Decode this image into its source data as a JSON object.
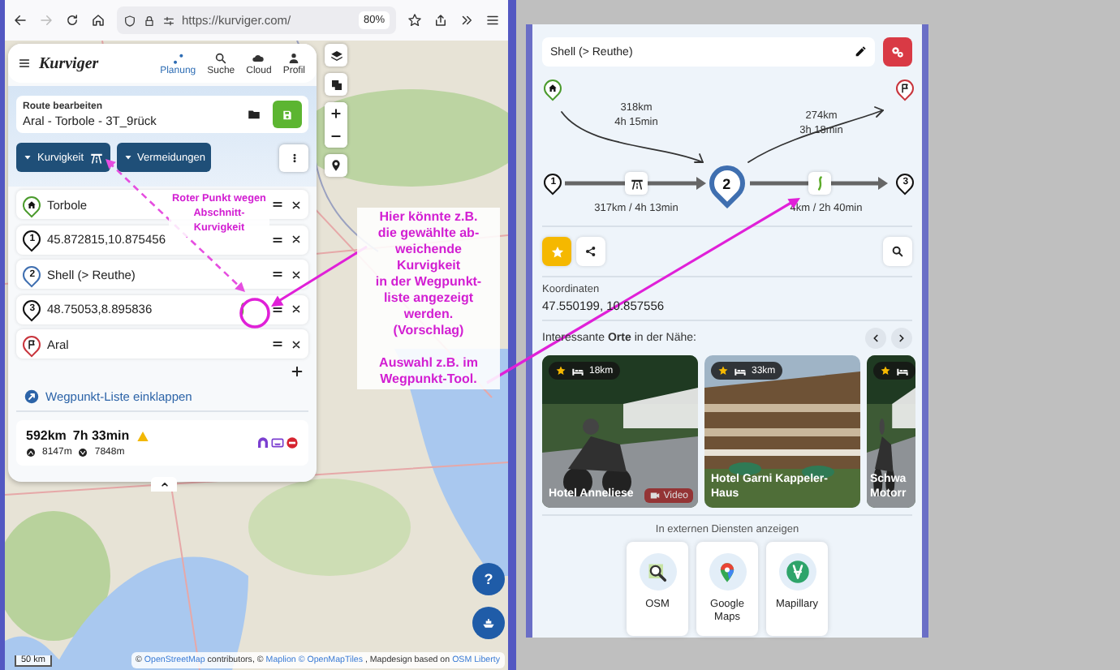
{
  "browser": {
    "url": "https://kurviger.com/",
    "zoom": "80%"
  },
  "app": {
    "logo": "Kurviger",
    "nav": [
      {
        "label": "Planung",
        "selected": true
      },
      {
        "label": "Suche",
        "selected": false
      },
      {
        "label": "Cloud",
        "selected": false
      },
      {
        "label": "Profil",
        "selected": false
      }
    ]
  },
  "route": {
    "heading": "Route bearbeiten",
    "name": "Aral - Torbole - 3T_9rück"
  },
  "filters": [
    {
      "label": "Kurvigkeit",
      "kind": "curviness"
    },
    {
      "label": "Vermeidungen",
      "kind": "avoid"
    }
  ],
  "waypoints": [
    {
      "kind": "start",
      "label": "Torbole",
      "color": "#4a9a2c",
      "custom_curviness": false
    },
    {
      "kind": "via",
      "number": "1",
      "label": "45.872815,10.875456",
      "color": "#111111",
      "custom_curviness": false
    },
    {
      "kind": "via",
      "number": "2",
      "label": "Shell (> Reuthe)",
      "color": "#3f6fb0",
      "custom_curviness": false
    },
    {
      "kind": "via",
      "number": "3",
      "label": "48.75053,8.895836",
      "color": "#111111",
      "custom_curviness": true
    },
    {
      "kind": "end",
      "label": "Aral",
      "color": "#c8343c",
      "custom_curviness": false
    }
  ],
  "collapse_link": "Wegpunkt-Liste einklappen",
  "summary": {
    "distance": "592km",
    "duration": "7h 33min",
    "ascent": "8147m",
    "descent": "7848m"
  },
  "map": {
    "scale": "50 km",
    "help": "?",
    "attribution": [
      {
        "text": "©",
        "link": false
      },
      {
        "text": "OpenStreetMap",
        "link": true
      },
      {
        "text": "contributors, ©",
        "link": false
      },
      {
        "text": "Maplion",
        "link": true
      },
      {
        "text": "© OpenMapTiles",
        "link": true
      },
      {
        "text": ", Mapdesign based on",
        "link": false
      },
      {
        "text": "OSM Liberty",
        "link": true
      }
    ]
  },
  "annotations": [
    {
      "text": "Roter Punkt wegen\nAbschnitt-\nKurvigkeit"
    },
    {
      "text": "Hier könnte z.B.\ndie gewählte ab-\nweichende\nKurvigkeit\nin der Wegpunkt-\nliste angezeigt\nwerden.\n(Vorschlag)\n\nAuswahl z.B. im\nWegpunkt-Tool."
    }
  ],
  "place": {
    "title": "Shell (> Reuthe)",
    "favorite": true
  },
  "route_diagram": {
    "previous": "1",
    "current": "2",
    "next": "3",
    "from_start": [
      "318km",
      "4h 15min"
    ],
    "to_end": [
      "274km",
      "3h 18min"
    ],
    "segment_in": "317km / 4h 13min",
    "segment_out": "4km / 2h 40min"
  },
  "coordinates": {
    "label": "Koordinaten",
    "value": "47.550199, 10.857556"
  },
  "nearby": {
    "title": "Interessante **Orte** in der Nähe:",
    "places": [
      {
        "title": "Hotel Anneliese",
        "distance": "18km",
        "video": "Video"
      },
      {
        "title": "Hotel Garni Kappeler-Haus",
        "distance": "33km"
      },
      {
        "title": "Schwa Motorr"
      }
    ]
  },
  "external": {
    "title": "In externen Diensten anzeigen",
    "services": [
      {
        "kind": "osm",
        "label": "OSM"
      },
      {
        "kind": "google",
        "label": "Google Maps"
      },
      {
        "kind": "mapillary",
        "label": "Mapillary"
      }
    ]
  }
}
